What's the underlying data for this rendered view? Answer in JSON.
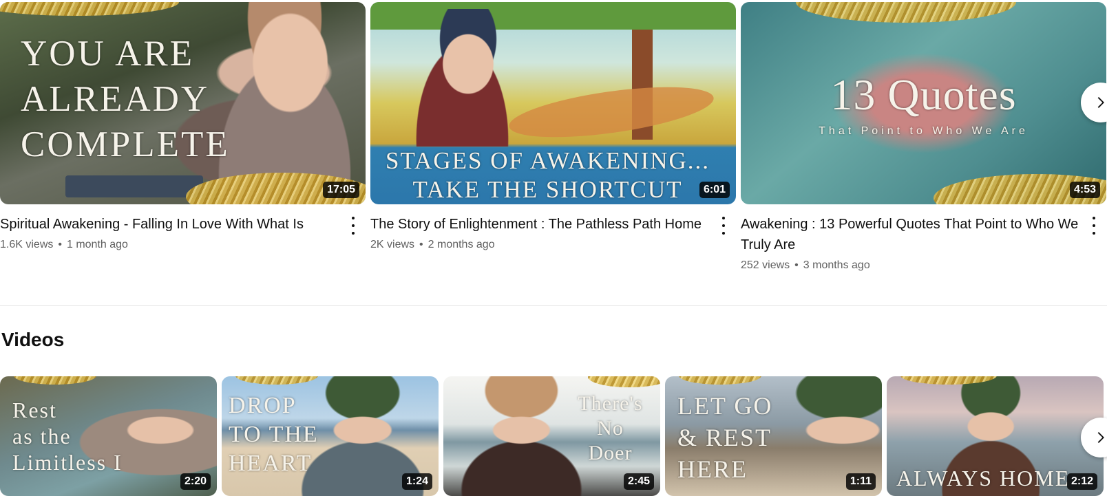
{
  "top_videos": [
    {
      "title": "Spiritual Awakening - Falling In Love With What Is",
      "views": "1.6K views",
      "age": "1 month ago",
      "duration": "17:05",
      "overlay": "YOU ARE\nALREADY\nCOMPLETE"
    },
    {
      "title": "The Story of Enlightenment : The Pathless Path Home",
      "views": "2K views",
      "age": "2 months ago",
      "duration": "6:01",
      "overlay": "STAGES OF AWAKENING...\nTAKE THE SHORTCUT"
    },
    {
      "title": "Awakening : 13 Powerful Quotes That Point to Who We Truly Are",
      "views": "252 views",
      "age": "3 months ago",
      "duration": "4:53",
      "overlay_main": "13 Quotes",
      "overlay_sub": "That Point to Who We Are"
    }
  ],
  "separator": "•",
  "section": {
    "title": "Videos"
  },
  "videos": [
    {
      "duration": "2:20",
      "overlay": "Rest\nas the\nLimitless I"
    },
    {
      "duration": "1:24",
      "overlay": "DROP\nTO THE\nHEART"
    },
    {
      "duration": "2:45",
      "overlay": "There's\nNo\nDoer"
    },
    {
      "duration": "1:11",
      "overlay": "LET GO\n& REST\nHERE"
    },
    {
      "duration": "2:12",
      "overlay": "ALWAYS HOME"
    }
  ],
  "icons": {
    "more": "more-vert-icon",
    "next": "chevron-right-icon"
  }
}
